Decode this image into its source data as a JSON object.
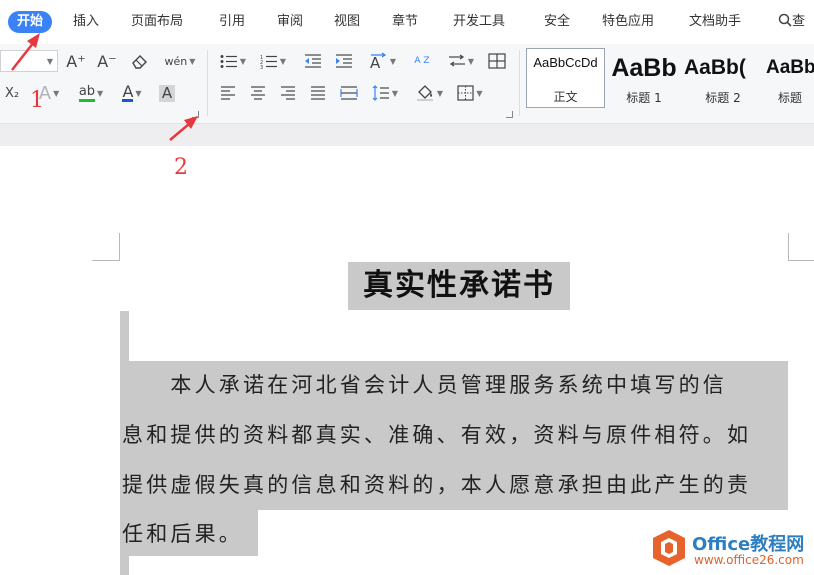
{
  "tabs": [
    {
      "label": "开始",
      "active": true
    },
    {
      "label": "插入"
    },
    {
      "label": "页面布局"
    },
    {
      "label": "引用"
    },
    {
      "label": "审阅"
    },
    {
      "label": "视图"
    },
    {
      "label": "章节"
    },
    {
      "label": "开发工具"
    },
    {
      "label": "安全"
    },
    {
      "label": "特色应用"
    },
    {
      "label": "文档助手"
    }
  ],
  "search_tab": {
    "icon": "search-icon",
    "label": "查"
  },
  "ribbon": {
    "font": {
      "grow_label": "A⁺",
      "shrink_label": "A⁻",
      "pinyin_label": "wén",
      "subscript_label": "X₂",
      "effect_label": "A",
      "highlight_label": "ab",
      "font_color_label": "A",
      "char_shading_label": "A",
      "highlight_color": "#22bb33",
      "font_color": "#2255cc"
    },
    "paragraph": {
      "sort_label": "A Z"
    },
    "styles": [
      {
        "sample": "AaBbCcDd",
        "label": "正文",
        "selected": true
      },
      {
        "sample": "AaBb",
        "label": "标题 1"
      },
      {
        "sample": "AaBb(",
        "label": "标题 2"
      },
      {
        "sample": "AaBb",
        "label": "标题"
      }
    ]
  },
  "annotations": {
    "one": "1",
    "two": "2"
  },
  "document": {
    "title": "真实性承诺书",
    "lines": [
      "　　本人承诺在河北省会计人员管理服务系统中填写的信",
      "息和提供的资料都真实、准确、有效，资料与原件相符。如",
      "提供虚假失真的信息和资料的，本人愿意承担由此产生的责",
      "任和后果。"
    ]
  },
  "watermark": {
    "main": "Office教程网",
    "sub": "www.office26.com"
  },
  "colors": {
    "accent": "#3b82f6",
    "annotation": "#e8383d",
    "selection": "#c9c9c9"
  }
}
